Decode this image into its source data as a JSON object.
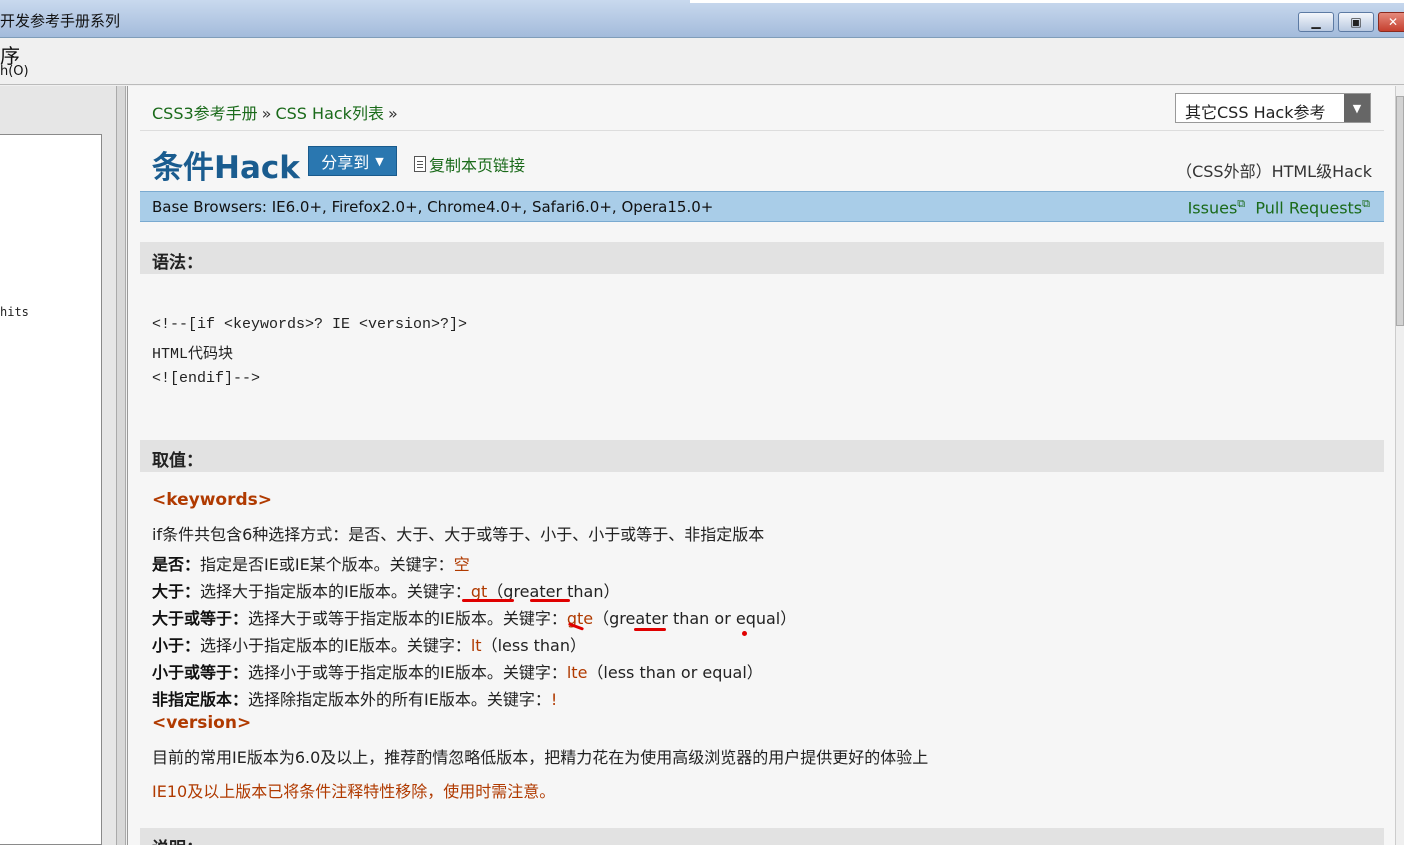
{
  "window": {
    "title": "开发参考手册系列",
    "menu_line1": "序",
    "menu_line2": "h(O)",
    "min_icon": "minimize-icon",
    "max_icon": "maximize-icon",
    "close_icon": "close-icon"
  },
  "left_pane": {
    "fragment": "hits"
  },
  "breadcrumb": {
    "item1": "CSS3参考手册",
    "sep": "»",
    "item2": "CSS Hack列表"
  },
  "other_select": {
    "label": "其它CSS Hack参考"
  },
  "header": {
    "title": "条件Hack",
    "share_label": "分享到",
    "copy_link_label": "复制本页链接",
    "hack_level": "（CSS外部）HTML级Hack"
  },
  "browsers": {
    "text": "Base Browsers: IE6.0+, Firefox2.0+, Chrome4.0+, Safari6.0+, Opera15.0+",
    "issues": "Issues",
    "pull_requests": "Pull Requests"
  },
  "syntax": {
    "heading": "语法：",
    "code": [
      "<!--[if <keywords>? IE <version>?]>",
      "HTML代码块",
      "<![endif]-->"
    ]
  },
  "values": {
    "heading": "取值：",
    "keywords_head": "<keywords>",
    "intro": "if条件共包含6种选择方式：是否、大于、大于或等于、小于、小于或等于、非指定版本",
    "rows": [
      {
        "label": "是否：",
        "desc": "指定是否IE或IE某个版本。关键字：",
        "kw": "空",
        "extra": ""
      },
      {
        "label": "大于：",
        "desc": "选择大于指定版本的IE版本。关键字：",
        "kw": "gt",
        "extra": "（greater than）"
      },
      {
        "label": "大于或等于：",
        "desc": "选择大于或等于指定版本的IE版本。关键字：",
        "kw": "gte",
        "extra": "（greater than or equal）"
      },
      {
        "label": "小于：",
        "desc": "选择小于指定版本的IE版本。关键字：",
        "kw": "lt",
        "extra": "（less than）"
      },
      {
        "label": "小于或等于：",
        "desc": "选择小于或等于指定版本的IE版本。关键字：",
        "kw": "lte",
        "extra": "（less than or equal）"
      },
      {
        "label": "非指定版本：",
        "desc": "选择除指定版本外的所有IE版本。关键字：",
        "kw": "!",
        "extra": ""
      }
    ],
    "version_head": "<version>",
    "version_desc": "目前的常用IE版本为6.0及以上，推荐酌情忽略低版本，把精力花在为使用高级浏览器的用户提供更好的体验上",
    "warning": "IE10及以上版本已将条件注释特性移除，使用时需注意。"
  },
  "notes": {
    "heading": "说明："
  }
}
